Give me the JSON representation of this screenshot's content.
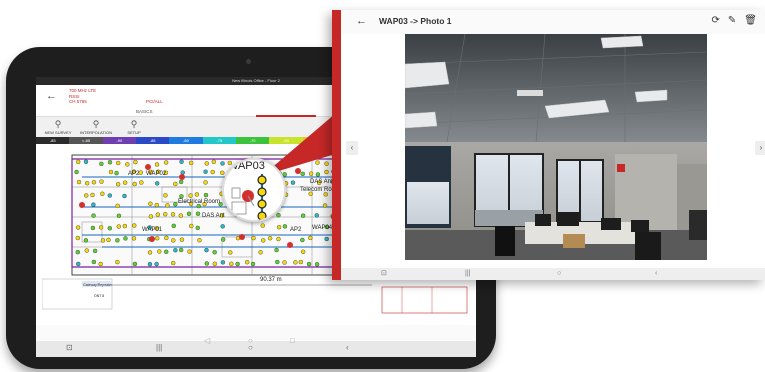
{
  "tablet": {
    "topbar": "New Illinois Office  -  Floor 2",
    "meta_lines": [
      "700 MHz LTE",
      "RSSI",
      "CH 5765"
    ],
    "meta_right": "PCI/ALL",
    "tab_label": "BASICS",
    "tools": [
      {
        "icon": "survey-icon",
        "label": "NEW SURVEY"
      },
      {
        "icon": "interpolation-icon",
        "label": "INTERPOLATION"
      },
      {
        "icon": "setup-icon",
        "label": "SETUP"
      }
    ],
    "scale": [
      {
        "label": "-85",
        "color": "#2b2b2b"
      },
      {
        "label": "<-85",
        "color": "#555555"
      },
      {
        "label": "-90",
        "color": "#6d3fb0"
      },
      {
        "label": "-85",
        "color": "#2a49c7"
      },
      {
        "label": "-80",
        "color": "#1f7be0"
      },
      {
        "label": "-75",
        "color": "#22c7c7"
      },
      {
        "label": "-70",
        "color": "#3cc23c"
      },
      {
        "label": "-65",
        "color": "#c9e22b"
      },
      {
        "label": "-60",
        "color": "#f2c21f"
      }
    ],
    "map_labels": {
      "wap02": "WAP02",
      "wap01": "WAP01",
      "wap04": "WAP04",
      "das_ant_1": "DAS Antenna",
      "das_ant_2": "DAS Ant",
      "telecom": "Telecom Room",
      "electrical": "Electrical Room",
      "ap2": "AP2",
      "distance": "90.37 m",
      "legend_title": "Gateway/Repeater",
      "legend_item": "ONT 8"
    },
    "nav": {
      "back": "◁",
      "home": "○",
      "recent": "□"
    }
  },
  "magnifier": {
    "label": "WAP03"
  },
  "photo_window": {
    "title": "WAP03 -> Photo 1",
    "back_icon": "arrow-left-icon",
    "actions": [
      "rotate-icon",
      "edit-icon",
      "delete-icon"
    ],
    "prev": "‹",
    "next": "›",
    "nav": {
      "menu": "⊡",
      "recent": "|||",
      "home": "○",
      "back": "‹"
    }
  },
  "colors": {
    "accent": "#c62828",
    "pin": "#d32f2f"
  }
}
